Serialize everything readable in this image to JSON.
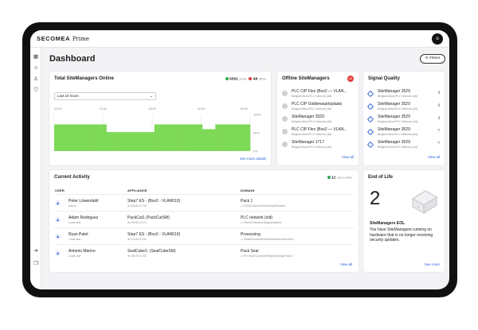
{
  "app": {
    "brand": "SECOMEA",
    "product": "Prime",
    "avatar_letter": "o"
  },
  "page": {
    "title": "Dashboard",
    "filters_label": "Filters"
  },
  "sidebar": {
    "icons": [
      "grid-icon",
      "users-icon",
      "user-gear-icon",
      "shield-icon",
      "logout-icon",
      "copy-icon"
    ]
  },
  "total": {
    "title": "Total SiteManagers Online",
    "online_count": "6502",
    "online_label": "online",
    "offline_count": "48",
    "offline_label": "offline",
    "range_label": "Last 24 hours",
    "time_ticks": [
      "00:00",
      "12:00",
      "18:00",
      "00:00",
      "06:00"
    ],
    "y_ticks": [
      "100%",
      "50%",
      "0%"
    ],
    "see_more": "See more details",
    "colors": {
      "online": "#2fa84f",
      "offline": "#e23c3c",
      "bar": "#7ed957"
    }
  },
  "chart_data": {
    "type": "area",
    "ylim": [
      0,
      100
    ],
    "values": [
      73,
      73,
      73,
      73,
      73,
      73,
      73,
      73,
      73,
      73,
      73,
      73,
      52,
      52,
      52,
      52,
      52,
      52,
      52,
      52,
      52,
      52,
      52,
      73,
      73,
      73,
      73,
      73,
      73,
      73,
      73,
      73,
      73,
      73,
      60,
      60,
      60,
      73,
      73,
      73,
      73,
      73,
      73,
      73,
      73
    ]
  },
  "offline": {
    "title": "Offline SiteManagers",
    "badge": "43",
    "items": [
      {
        "name": "PLC CIP Flex (Box2 — VLAN...",
        "sub": "Belgium/Aiken/PLC Network (old)"
      },
      {
        "name": "PLC CIP Gistbewaartsplaats",
        "sub": "Belgium/Aiken/PLC Network (old)"
      },
      {
        "name": "SiteManager 3529",
        "sub": "Belgium/Aiken/PLC Network (old)"
      },
      {
        "name": "PLC CIP Flex (Box2 — VLAN...",
        "sub": "Belgium/Aiken/PLC Network (old)"
      },
      {
        "name": "SiteManager 1717",
        "sub": "Belgium/Aiken/PLC Network (old)"
      }
    ],
    "view_all": "View all"
  },
  "signal": {
    "title": "Signal Quality",
    "items": [
      {
        "name": "SiteManager 3529",
        "sub": "Belgium/Aiken/PLC Network (old)",
        "icon": "signal-bars-icon",
        "glyph": "ıl"
      },
      {
        "name": "SiteManager 3529",
        "sub": "Belgium/Aiken/PLC Network (old)",
        "icon": "signal-bars-icon",
        "glyph": "ıl"
      },
      {
        "name": "SiteManager 3529",
        "sub": "Belgium/Aiken/PLC Network (old)",
        "icon": "signal-bars-icon",
        "glyph": "ıl"
      },
      {
        "name": "SiteManager 3529",
        "sub": "Belgium/Aiken/PLC Network (old)",
        "icon": "help-icon",
        "glyph": "?"
      },
      {
        "name": "SiteManager 3529",
        "sub": "Belgium/Aiken/PLC Network (old)",
        "icon": "help-icon",
        "glyph": "?"
      }
    ],
    "view_all": "View all"
  },
  "activity": {
    "title": "Current Activity",
    "users_online_count": "12",
    "users_online_label": "users online",
    "columns": [
      "USER",
      "APPLIANCE",
      "DOMAIN"
    ],
    "rows": [
      {
        "user": "Peter Löwendahl",
        "role": "Admin",
        "appliance": "Step7 ES - (Box2 - VLAN510)",
        "ip": "195.82.0.134",
        "domain": "Pack 1",
        "path": "Fuhr/Customer/Germany/Dresden/"
      },
      {
        "user": "Adam Rodriguez",
        "role": "Local user",
        "appliance": "PackCut1 (PackCutSM)",
        "ip": "195.82.0.174",
        "domain": "PLC network (old)",
        "path": "Mbed/Customer/Belgium/Aiken/"
      },
      {
        "user": "Ryan Patel",
        "role": "Local user",
        "appliance": "Step7 ES - (Box2 - VLAN510)",
        "ip": "132.54.9.232",
        "domain": "Processing",
        "path": "Retail/Customer/Netherlands/Leiden/Hal 1"
      },
      {
        "user": "Antonio Marino",
        "role": "Local user",
        "appliance": "SealCube1- (SealCubeSM)",
        "ip": "195.79.0.151",
        "domain": "Pack Seal",
        "path": "Pol Seal/Customer/Belgium/Liege/Pack 3"
      }
    ],
    "view_all": "View all"
  },
  "eol": {
    "title": "End of Life",
    "count": "2",
    "subtitle": "SiteManagers EOL",
    "text": "You have SiteManagers running on hardware that is no longer receiving security updates.",
    "see_more": "See more"
  }
}
